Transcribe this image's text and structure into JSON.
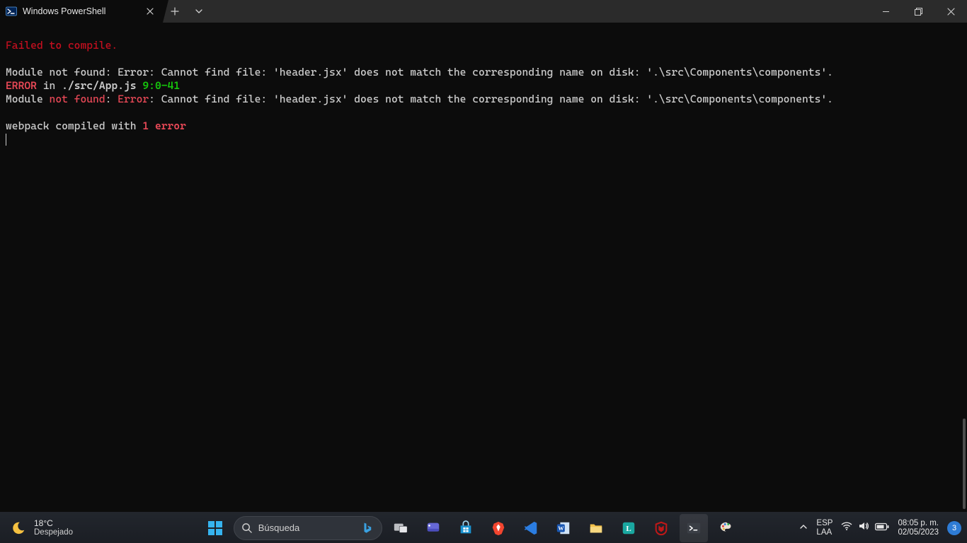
{
  "titlebar": {
    "tab_title": "Windows PowerShell"
  },
  "terminal": {
    "l1": "Failed to compile.",
    "l2": "",
    "l3": "Module not found: Error: Cannot find file: 'header.jsx' does not match the corresponding name on disk: '.\\src\\Components\\components'.",
    "l4_pre": "ERROR",
    "l4_mid": " in ",
    "l4_file": "./src/App.js",
    "l4_sp": " ",
    "l4_loc": "9:0-41",
    "l5_a": "Module ",
    "l5_b": "not found",
    "l5_c": ": ",
    "l5_d": "Error",
    "l5_e": ": Cannot find file: 'header.jsx' does not match the corresponding name on disk: '.\\src\\Components\\components'.",
    "l6": "",
    "l7_a": "webpack compiled with ",
    "l7_b": "1 error"
  },
  "taskbar": {
    "weather_temp": "18°C",
    "weather_cond": "Despejado",
    "search_placeholder": "Búsqueda",
    "lang_top": "ESP",
    "lang_bottom": "LAA",
    "clock_top": "08:05 p. m.",
    "clock_bottom": "02/05/2023",
    "notif_count": "3"
  }
}
